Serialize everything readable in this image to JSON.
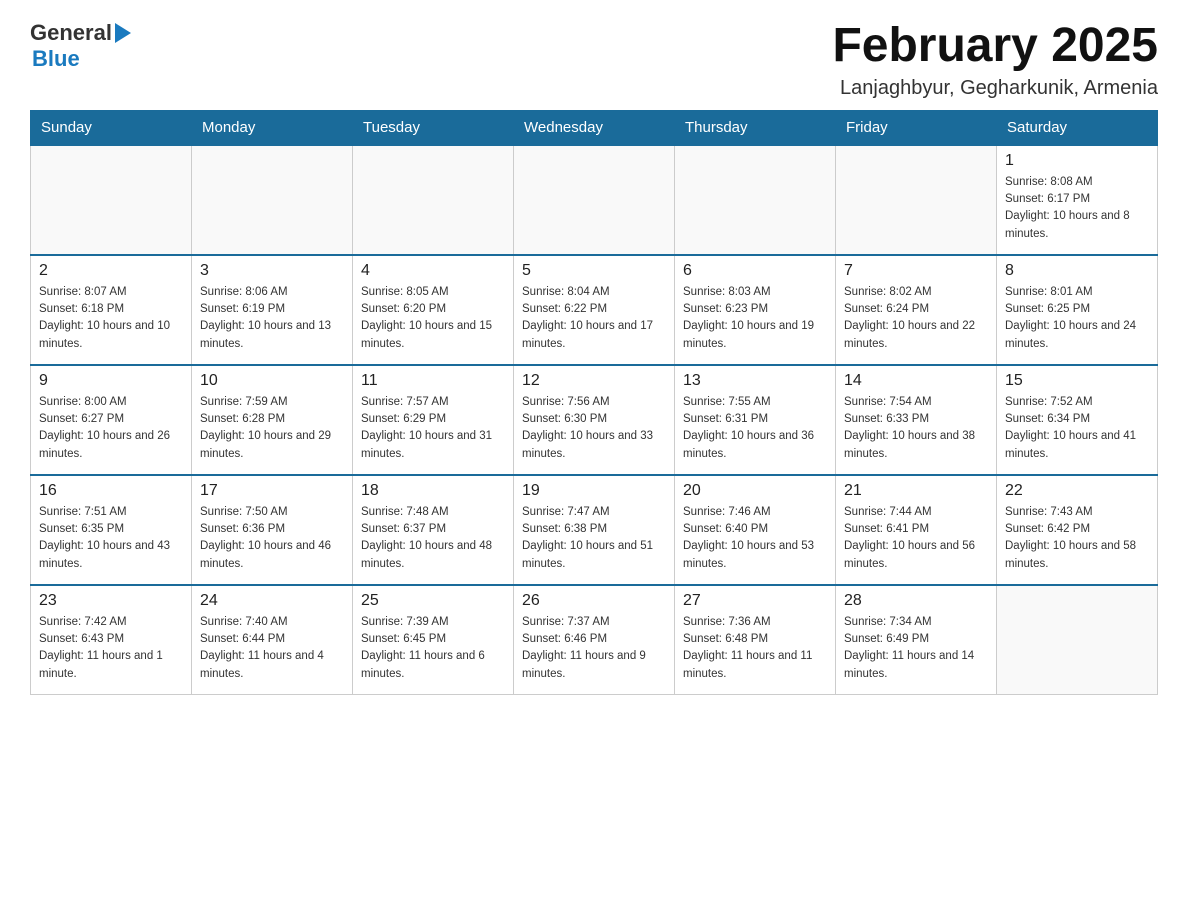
{
  "header": {
    "logo_general": "General",
    "logo_blue": "Blue",
    "month_title": "February 2025",
    "location": "Lanjaghbyur, Gegharkunik, Armenia"
  },
  "weekdays": [
    "Sunday",
    "Monday",
    "Tuesday",
    "Wednesday",
    "Thursday",
    "Friday",
    "Saturday"
  ],
  "weeks": [
    {
      "days": [
        {
          "number": "",
          "info": ""
        },
        {
          "number": "",
          "info": ""
        },
        {
          "number": "",
          "info": ""
        },
        {
          "number": "",
          "info": ""
        },
        {
          "number": "",
          "info": ""
        },
        {
          "number": "",
          "info": ""
        },
        {
          "number": "1",
          "info": "Sunrise: 8:08 AM\nSunset: 6:17 PM\nDaylight: 10 hours and 8 minutes."
        }
      ]
    },
    {
      "days": [
        {
          "number": "2",
          "info": "Sunrise: 8:07 AM\nSunset: 6:18 PM\nDaylight: 10 hours and 10 minutes."
        },
        {
          "number": "3",
          "info": "Sunrise: 8:06 AM\nSunset: 6:19 PM\nDaylight: 10 hours and 13 minutes."
        },
        {
          "number": "4",
          "info": "Sunrise: 8:05 AM\nSunset: 6:20 PM\nDaylight: 10 hours and 15 minutes."
        },
        {
          "number": "5",
          "info": "Sunrise: 8:04 AM\nSunset: 6:22 PM\nDaylight: 10 hours and 17 minutes."
        },
        {
          "number": "6",
          "info": "Sunrise: 8:03 AM\nSunset: 6:23 PM\nDaylight: 10 hours and 19 minutes."
        },
        {
          "number": "7",
          "info": "Sunrise: 8:02 AM\nSunset: 6:24 PM\nDaylight: 10 hours and 22 minutes."
        },
        {
          "number": "8",
          "info": "Sunrise: 8:01 AM\nSunset: 6:25 PM\nDaylight: 10 hours and 24 minutes."
        }
      ]
    },
    {
      "days": [
        {
          "number": "9",
          "info": "Sunrise: 8:00 AM\nSunset: 6:27 PM\nDaylight: 10 hours and 26 minutes."
        },
        {
          "number": "10",
          "info": "Sunrise: 7:59 AM\nSunset: 6:28 PM\nDaylight: 10 hours and 29 minutes."
        },
        {
          "number": "11",
          "info": "Sunrise: 7:57 AM\nSunset: 6:29 PM\nDaylight: 10 hours and 31 minutes."
        },
        {
          "number": "12",
          "info": "Sunrise: 7:56 AM\nSunset: 6:30 PM\nDaylight: 10 hours and 33 minutes."
        },
        {
          "number": "13",
          "info": "Sunrise: 7:55 AM\nSunset: 6:31 PM\nDaylight: 10 hours and 36 minutes."
        },
        {
          "number": "14",
          "info": "Sunrise: 7:54 AM\nSunset: 6:33 PM\nDaylight: 10 hours and 38 minutes."
        },
        {
          "number": "15",
          "info": "Sunrise: 7:52 AM\nSunset: 6:34 PM\nDaylight: 10 hours and 41 minutes."
        }
      ]
    },
    {
      "days": [
        {
          "number": "16",
          "info": "Sunrise: 7:51 AM\nSunset: 6:35 PM\nDaylight: 10 hours and 43 minutes."
        },
        {
          "number": "17",
          "info": "Sunrise: 7:50 AM\nSunset: 6:36 PM\nDaylight: 10 hours and 46 minutes."
        },
        {
          "number": "18",
          "info": "Sunrise: 7:48 AM\nSunset: 6:37 PM\nDaylight: 10 hours and 48 minutes."
        },
        {
          "number": "19",
          "info": "Sunrise: 7:47 AM\nSunset: 6:38 PM\nDaylight: 10 hours and 51 minutes."
        },
        {
          "number": "20",
          "info": "Sunrise: 7:46 AM\nSunset: 6:40 PM\nDaylight: 10 hours and 53 minutes."
        },
        {
          "number": "21",
          "info": "Sunrise: 7:44 AM\nSunset: 6:41 PM\nDaylight: 10 hours and 56 minutes."
        },
        {
          "number": "22",
          "info": "Sunrise: 7:43 AM\nSunset: 6:42 PM\nDaylight: 10 hours and 58 minutes."
        }
      ]
    },
    {
      "days": [
        {
          "number": "23",
          "info": "Sunrise: 7:42 AM\nSunset: 6:43 PM\nDaylight: 11 hours and 1 minute."
        },
        {
          "number": "24",
          "info": "Sunrise: 7:40 AM\nSunset: 6:44 PM\nDaylight: 11 hours and 4 minutes."
        },
        {
          "number": "25",
          "info": "Sunrise: 7:39 AM\nSunset: 6:45 PM\nDaylight: 11 hours and 6 minutes."
        },
        {
          "number": "26",
          "info": "Sunrise: 7:37 AM\nSunset: 6:46 PM\nDaylight: 11 hours and 9 minutes."
        },
        {
          "number": "27",
          "info": "Sunrise: 7:36 AM\nSunset: 6:48 PM\nDaylight: 11 hours and 11 minutes."
        },
        {
          "number": "28",
          "info": "Sunrise: 7:34 AM\nSunset: 6:49 PM\nDaylight: 11 hours and 14 minutes."
        },
        {
          "number": "",
          "info": ""
        }
      ]
    }
  ]
}
